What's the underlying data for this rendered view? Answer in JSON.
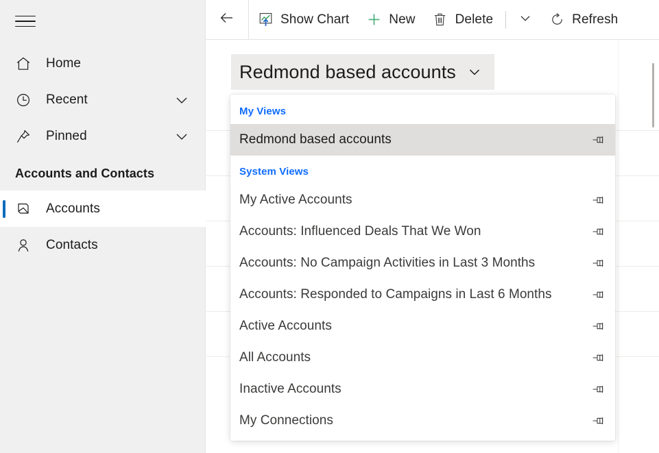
{
  "sidebar": {
    "menu_button": "hamburger-menu",
    "items": [
      {
        "label": "Home",
        "icon": "home-icon",
        "has_chevron": false
      },
      {
        "label": "Recent",
        "icon": "clock-icon",
        "has_chevron": true
      },
      {
        "label": "Pinned",
        "icon": "pin-icon",
        "has_chevron": true
      }
    ],
    "group_header": "Accounts and Contacts",
    "entities": [
      {
        "label": "Accounts",
        "icon": "accounts-icon",
        "selected": true
      },
      {
        "label": "Contacts",
        "icon": "contact-person-icon",
        "selected": false
      }
    ]
  },
  "commandbar": {
    "back_label": "Back",
    "buttons": [
      {
        "label": "Show Chart",
        "icon": "show-chart-icon"
      },
      {
        "label": "New",
        "icon": "plus-icon"
      },
      {
        "label": "Delete",
        "icon": "trash-icon"
      }
    ],
    "overflow_label": "More commands",
    "refresh": {
      "label": "Refresh",
      "icon": "refresh-icon"
    }
  },
  "view_selector": {
    "current_view": "Redmond based accounts",
    "caret": "chevron-down-icon",
    "expanded": true
  },
  "view_flyout": {
    "sections": [
      {
        "title": "My Views",
        "items": [
          {
            "label": "Redmond based accounts",
            "pin": "pin-icon",
            "current": true
          }
        ]
      },
      {
        "title": "System Views",
        "items": [
          {
            "label": "My Active Accounts",
            "pin": "pin-icon",
            "current": false
          },
          {
            "label": "Accounts: Influenced Deals That We Won",
            "pin": "pin-icon",
            "current": false
          },
          {
            "label": "Accounts: No Campaign Activities in Last 3 Months",
            "pin": "pin-icon",
            "current": false
          },
          {
            "label": "Accounts: Responded to Campaigns in Last 6 Months",
            "pin": "pin-icon",
            "current": false
          },
          {
            "label": "Active Accounts",
            "pin": "pin-icon",
            "current": false
          },
          {
            "label": "All Accounts",
            "pin": "pin-icon",
            "current": false
          },
          {
            "label": "Inactive Accounts",
            "pin": "pin-icon",
            "current": false
          },
          {
            "label": "My Connections",
            "pin": "pin-icon",
            "current": false
          }
        ]
      }
    ]
  },
  "colors": {
    "accent": "#0f6cbd",
    "section_link": "#0f6cff",
    "sidebar_bg": "#f0f0f0",
    "selected_row": "#e0dedc",
    "view_pill_bg": "#edebe9",
    "new_plus": "#4caf7d",
    "chart_line": "#2e9c5a",
    "chart_arrow": "#1f62c4"
  }
}
